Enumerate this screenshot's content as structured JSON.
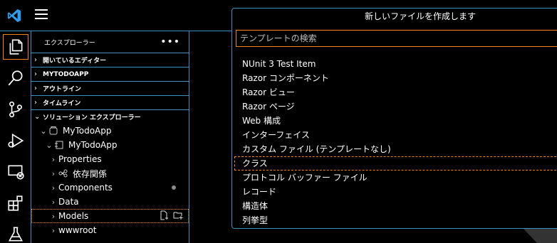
{
  "explorer": {
    "title": "エクスプローラー",
    "more": "•••",
    "sections": [
      {
        "label": "開いているエディター"
      },
      {
        "label": "MYTODOAPP"
      },
      {
        "label": "アウトライン"
      },
      {
        "label": "タイムライン"
      },
      {
        "label": "ソリューション エクスプローラー"
      }
    ],
    "tree": [
      {
        "label": "MyTodoApp"
      },
      {
        "label": "MyTodoApp"
      },
      {
        "label": "Properties"
      },
      {
        "label": "依存関係"
      },
      {
        "label": "Components"
      },
      {
        "label": "Data"
      },
      {
        "label": "Models"
      },
      {
        "label": "wwwroot"
      }
    ]
  },
  "quickpick": {
    "title": "新しいファイルを作成します",
    "placeholder": "テンプレートの検索",
    "items": [
      {
        "label": "NUnit 3 Test Item"
      },
      {
        "label": "Razor コンポーネント"
      },
      {
        "label": "Razor ビュー"
      },
      {
        "label": "Razor ページ"
      },
      {
        "label": "Web 構成"
      },
      {
        "label": "インターフェイス"
      },
      {
        "label": "カスタム ファイル (テンプレートなし)"
      },
      {
        "label": "クラス"
      },
      {
        "label": "プロトコル バッファー ファイル"
      },
      {
        "label": "レコード"
      },
      {
        "label": "構造体"
      },
      {
        "label": "列挙型"
      }
    ]
  },
  "colors": {
    "accent_border": "#3a8ec4",
    "focus_border": "#f38518",
    "vscode_blue": "#2f9bea"
  }
}
